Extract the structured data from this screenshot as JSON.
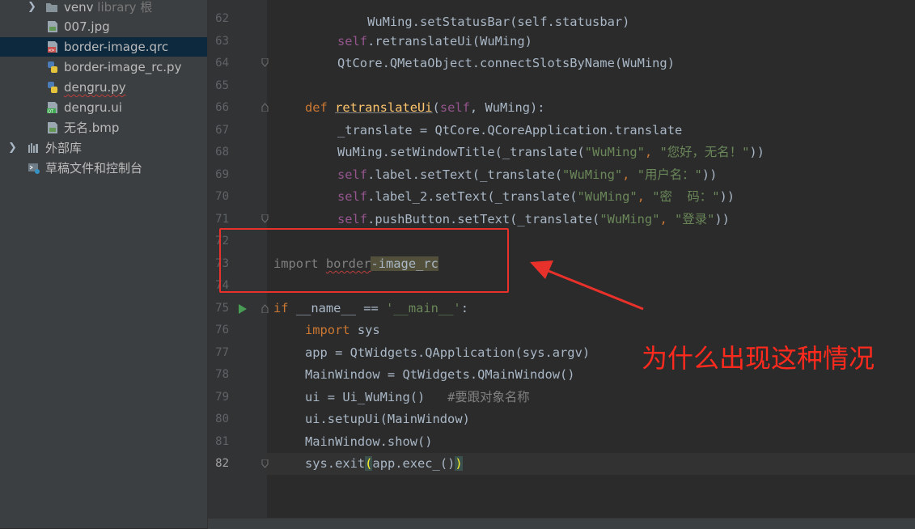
{
  "project_tree": {
    "items": [
      {
        "name": "venv",
        "hint": "library 根"
      },
      {
        "name": "007.jpg"
      },
      {
        "name": "border-image.qrc"
      },
      {
        "name": "border-image_rc.py"
      },
      {
        "name": "dengru.py"
      },
      {
        "name": "dengru.ui"
      },
      {
        "name": "无名.bmp"
      },
      {
        "name": "外部库"
      },
      {
        "name": "草稿文件和控制台"
      }
    ]
  },
  "editor": {
    "line_numbers": [
      "62",
      "63",
      "64",
      "65",
      "66",
      "67",
      "68",
      "69",
      "70",
      "71",
      "72",
      "73",
      "74",
      "75",
      "76",
      "77",
      "78",
      "79",
      "80",
      "81",
      "82"
    ],
    "top_partial": "WuMing.setStatusBar(self.statusbar)",
    "lines": {
      "l63": {
        "self": "self",
        "rest": ".retranslateUi(WuMing)"
      },
      "l64": "QtCore.QMetaObject.connectSlotsByName(WuMing)",
      "l66": {
        "def": "def ",
        "fn": "retranslateUi",
        "open": "(",
        "self": "self",
        "rest": ", WuMing):"
      },
      "l67": "_translate = QtCore.QCoreApplication.translate",
      "l68": {
        "a": "WuMing.setWindowTitle(_translate(",
        "s1": "\"WuMing\"",
        "c": ", ",
        "s2": "\"您好，无名！\"",
        "e": "))"
      },
      "l69": {
        "self": "self",
        "a": ".label.setText(_translate(",
        "s1": "\"WuMing\"",
        "c": ", ",
        "s2": "\"用户名：\"",
        "e": "))"
      },
      "l70": {
        "self": "self",
        "a": ".label_2.setText(_translate(",
        "s1": "\"WuMing\"",
        "c": ", ",
        "s2": "\"密  码：\"",
        "e": "))"
      },
      "l71": {
        "self": "self",
        "a": ".pushButton.setText(_translate(",
        "s1": "\"WuMing\"",
        "c": ", ",
        "s2": "\"登录\"",
        "e": "))"
      },
      "l73": {
        "imp": "import ",
        "m1": "border",
        "m2": "-image_rc"
      },
      "l75": {
        "kw": "if ",
        "a": "__name__ == ",
        "s": "'__main__'",
        "e": ":"
      },
      "l76": {
        "kw": "import ",
        "a": "sys"
      },
      "l77": "app = QtWidgets.QApplication(sys.argv)",
      "l78": "MainWindow = QtWidgets.QMainWindow()",
      "l79": {
        "a": "ui = Ui_WuMing()   ",
        "cmt": "#要跟对象名称"
      },
      "l80": "ui.setupUi(MainWindow)",
      "l81": "MainWindow.show()",
      "l82": {
        "a": "sys.exit",
        "b1": "(",
        "m": "app.exec_()",
        "b2": ")"
      }
    }
  },
  "annotation": {
    "text": "为什么出现这种情况",
    "color": "#ff2a1e"
  },
  "colors": {
    "sidebar_bg": "#3c3f41",
    "editor_bg": "#2b2b2b",
    "keyword": "#cc7832",
    "string": "#6a8759",
    "function": "#ffc66d",
    "self": "#94558d"
  }
}
